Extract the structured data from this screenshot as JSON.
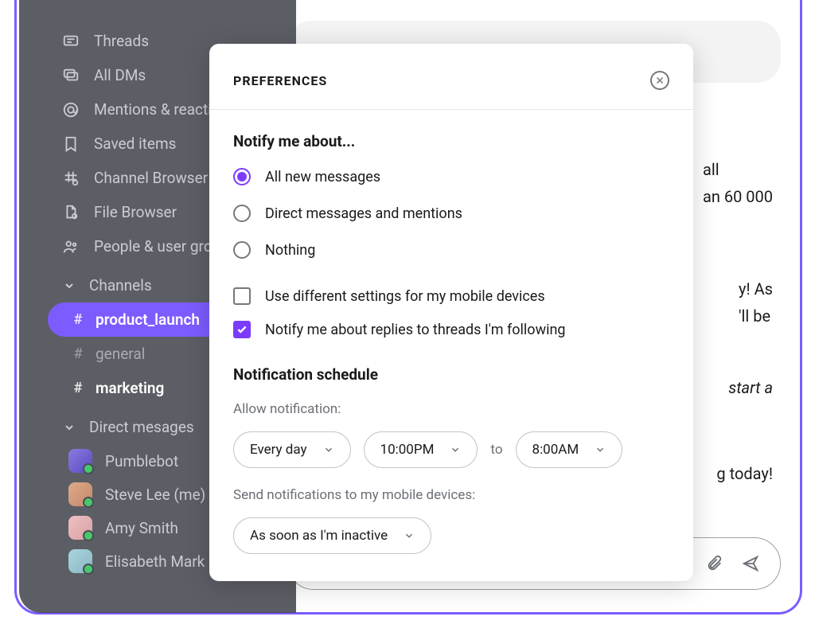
{
  "sidebar": {
    "nav": [
      {
        "icon": "threads",
        "label": "Threads"
      },
      {
        "icon": "dms",
        "label": "All DMs"
      },
      {
        "icon": "mentions",
        "label": "Mentions & reactions"
      },
      {
        "icon": "saved",
        "label": "Saved items"
      },
      {
        "icon": "channelbrowser",
        "label": "Channel Browser"
      },
      {
        "icon": "filebrowser",
        "label": "File Browser"
      },
      {
        "icon": "people",
        "label": "People & user groups"
      }
    ],
    "channels_header": "Channels",
    "channels": [
      {
        "name": "product_launch",
        "active": true
      },
      {
        "name": "general",
        "active": false,
        "muted": true
      },
      {
        "name": "marketing",
        "active": false
      }
    ],
    "dms_header": "Direct mesages",
    "dms": [
      {
        "name": "Pumblebot",
        "color": "#8a7be0"
      },
      {
        "name": "Steve Lee (me)",
        "color": "#e0a98a"
      },
      {
        "name": "Amy Smith",
        "color": "#eec0c3"
      },
      {
        "name": "Elisabeth Mark",
        "color": "#a9d6e0"
      }
    ]
  },
  "messages": {
    "m1_line1": "all",
    "m1_line2": "an 60 000",
    "m2_line1": "y! As",
    "m2_line2": "'ll be",
    "m2_line3": "start a",
    "m2_line3_style": "italic",
    "m3": "g today!"
  },
  "modal": {
    "title": "PREFERENCES",
    "notify_heading": "Notify me about...",
    "radios": [
      {
        "label": "All new messages",
        "selected": true
      },
      {
        "label": "Direct messages and mentions",
        "selected": false
      },
      {
        "label": "Nothing",
        "selected": false
      }
    ],
    "checkboxes": [
      {
        "label": "Use different settings for my mobile devices",
        "checked": false
      },
      {
        "label": "Notify me about replies to threads I'm following",
        "checked": true
      }
    ],
    "schedule_heading": "Notification schedule",
    "allow_label": "Allow notification:",
    "day_value": "Every day",
    "start_value": "10:00PM",
    "to_label": "to",
    "end_value": "8:00AM",
    "mobile_label": "Send notifications to my mobile devices:",
    "mobile_value": "As soon as I'm inactive"
  }
}
